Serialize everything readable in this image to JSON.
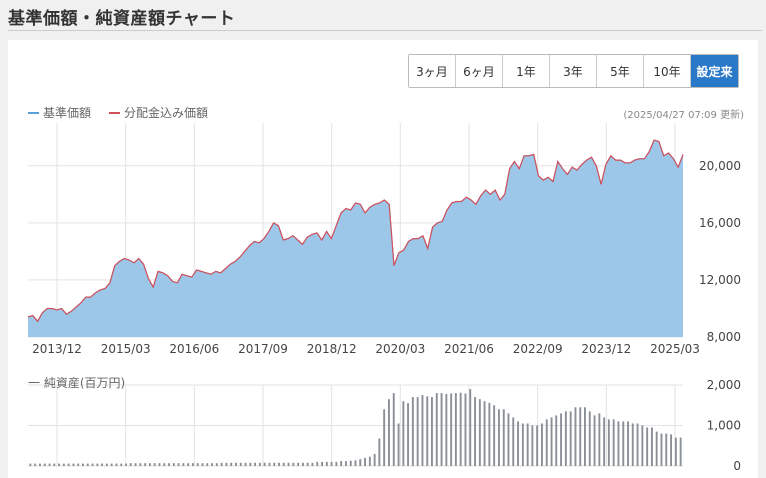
{
  "page": {
    "title": "基準価額・純資産額チャート"
  },
  "range_buttons": [
    {
      "label": "3ヶ月",
      "active": false
    },
    {
      "label": "6ヶ月",
      "active": false
    },
    {
      "label": "1年",
      "active": false
    },
    {
      "label": "3年",
      "active": false
    },
    {
      "label": "5年",
      "active": false
    },
    {
      "label": "10年",
      "active": false
    },
    {
      "label": "設定来",
      "active": true
    }
  ],
  "legend": {
    "nav_label": "基準価額",
    "dividend_label": "分配金込み価額",
    "nav_color": "#5a9fd8",
    "dividend_color": "#d0505a"
  },
  "updated_text": "(2025/04/27 07:09 更新)",
  "net_assets_title": "一 純資産(百万円)",
  "chart_data": [
    {
      "type": "area",
      "x_tick_labels": [
        "2013/12",
        "2015/03",
        "2016/06",
        "2017/09",
        "2018/12",
        "2020/03",
        "2021/06",
        "2022/09",
        "2023/12",
        "2025/03"
      ],
      "y_tick_labels": [
        "8,000",
        "12,000",
        "16,000",
        "20,000"
      ],
      "ylim": [
        8000,
        23000
      ],
      "grid": true,
      "series": [
        {
          "name": "基準価額",
          "values": [
            9400,
            9500,
            9100,
            9700,
            10000,
            10000,
            9900,
            10000,
            9600,
            9800,
            10100,
            10400,
            10800,
            10800,
            11100,
            11300,
            11400,
            11800,
            13000,
            13300,
            13500,
            13400,
            13200,
            13500,
            13100,
            12100,
            11500,
            12600,
            12500,
            12300,
            11900,
            11800,
            12400,
            12300,
            12200,
            12700,
            12600,
            12500,
            12400,
            12600,
            12500,
            12800,
            13100,
            13300,
            13600,
            14000,
            14400,
            14700,
            14600,
            14900,
            15400,
            16000,
            15800,
            14800,
            14900,
            15100,
            14800,
            14500,
            15000,
            15200,
            15300,
            14800,
            15400,
            14900,
            15800,
            16700,
            17000,
            16900,
            17400,
            17300,
            16700,
            17100,
            17300,
            17400,
            17600,
            17300,
            13000,
            13900,
            14100,
            14700,
            14900,
            14900,
            15100,
            14200,
            15700,
            16000,
            16100,
            16900,
            17400,
            17500,
            17500,
            17800,
            17600,
            17300,
            17900,
            18300,
            18000,
            18300,
            17600,
            18000,
            19800,
            20300,
            19800,
            20700,
            20700,
            20800,
            19300,
            19000,
            19200,
            18900,
            20300,
            19800,
            19400,
            19900,
            19700,
            20100,
            20400,
            20600,
            20000,
            18700,
            20100,
            20700,
            20400,
            20400,
            20200,
            20200,
            20400,
            20500,
            20500,
            21000,
            21800,
            21700,
            20700,
            20900,
            20500,
            19900,
            20800
          ],
          "color": "#5a9fd8"
        },
        {
          "name": "分配金込み価額",
          "values": [
            9400,
            9500,
            9100,
            9700,
            10000,
            10000,
            9900,
            10000,
            9600,
            9800,
            10100,
            10400,
            10800,
            10800,
            11100,
            11300,
            11400,
            11800,
            13000,
            13300,
            13500,
            13400,
            13200,
            13500,
            13100,
            12100,
            11500,
            12600,
            12500,
            12300,
            11900,
            11800,
            12400,
            12300,
            12200,
            12700,
            12600,
            12500,
            12400,
            12600,
            12500,
            12800,
            13100,
            13300,
            13600,
            14000,
            14400,
            14700,
            14600,
            14900,
            15400,
            16000,
            15800,
            14800,
            14900,
            15100,
            14800,
            14500,
            15000,
            15200,
            15300,
            14800,
            15400,
            14900,
            15800,
            16700,
            17000,
            16900,
            17400,
            17300,
            16700,
            17100,
            17300,
            17400,
            17600,
            17300,
            13000,
            13900,
            14100,
            14700,
            14900,
            14900,
            15100,
            14200,
            15700,
            16000,
            16100,
            16900,
            17400,
            17500,
            17500,
            17800,
            17600,
            17300,
            17900,
            18300,
            18000,
            18300,
            17600,
            18000,
            19800,
            20300,
            19800,
            20700,
            20700,
            20800,
            19300,
            19000,
            19200,
            18900,
            20300,
            19800,
            19400,
            19900,
            19700,
            20100,
            20400,
            20600,
            20000,
            18700,
            20100,
            20700,
            20400,
            20400,
            20200,
            20200,
            20400,
            20500,
            20500,
            21000,
            21800,
            21700,
            20700,
            20900,
            20500,
            19900,
            20800
          ],
          "color": "#d0505a"
        }
      ]
    },
    {
      "type": "bar",
      "y_tick_labels": [
        "0",
        "1,000",
        "2,000"
      ],
      "ylim": [
        0,
        2000
      ],
      "grid": true,
      "series": [
        {
          "name": "純資産",
          "values": [
            60,
            60,
            60,
            60,
            60,
            60,
            60,
            60,
            60,
            60,
            60,
            60,
            60,
            60,
            60,
            60,
            60,
            60,
            60,
            60,
            60,
            70,
            70,
            70,
            70,
            70,
            70,
            70,
            70,
            70,
            70,
            70,
            70,
            70,
            70,
            70,
            70,
            70,
            70,
            70,
            80,
            80,
            80,
            80,
            80,
            80,
            80,
            80,
            80,
            80,
            80,
            80,
            80,
            80,
            80,
            80,
            80,
            80,
            80,
            80,
            100,
            100,
            100,
            100,
            100,
            120,
            120,
            130,
            140,
            170,
            200,
            230,
            300,
            680,
            1400,
            1650,
            1800,
            1050,
            1600,
            1550,
            1700,
            1700,
            1750,
            1720,
            1700,
            1800,
            1800,
            1780,
            1790,
            1800,
            1810,
            1790,
            1900,
            1700,
            1650,
            1600,
            1560,
            1500,
            1400,
            1400,
            1300,
            1200,
            1100,
            1050,
            1050,
            1000,
            1000,
            1050,
            1150,
            1200,
            1250,
            1300,
            1350,
            1350,
            1450,
            1450,
            1450,
            1350,
            1250,
            1300,
            1200,
            1150,
            1150,
            1100,
            1100,
            1100,
            1050,
            1050,
            1000,
            950,
            950,
            850,
            800,
            800,
            780,
            700,
            700
          ],
          "color": "#8a9098"
        }
      ]
    }
  ]
}
